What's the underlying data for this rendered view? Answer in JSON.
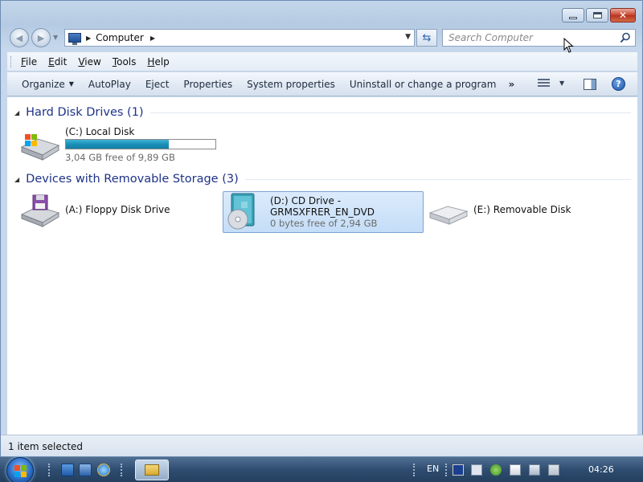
{
  "navigation": {
    "breadcrumb": [
      "Computer"
    ],
    "search_placeholder": "Search Computer"
  },
  "menu": [
    "File",
    "Edit",
    "View",
    "Tools",
    "Help"
  ],
  "menu_mnemonics": [
    "F",
    "E",
    "V",
    "T",
    "H"
  ],
  "commands": {
    "organize": "Organize",
    "autoplay": "AutoPlay",
    "eject": "Eject",
    "properties": "Properties",
    "system_properties": "System properties",
    "uninstall": "Uninstall or change a program",
    "more": "»"
  },
  "groups": [
    {
      "title": "Hard Disk Drives (1)",
      "items": [
        {
          "name": "(C:) Local Disk",
          "info": "3,04 GB free of 9,89 GB",
          "used_fraction": 0.69,
          "icon": "hard-disk-icon"
        }
      ]
    },
    {
      "title": "Devices with Removable Storage (3)",
      "items": [
        {
          "name": "(A:) Floppy Disk Drive",
          "icon": "floppy-drive-icon"
        },
        {
          "name_line1": "(D:) CD Drive -",
          "name_line2": "GRMSXFRER_EN_DVD",
          "info": "0 bytes free of 2,94 GB",
          "icon": "cd-drive-icon",
          "selected": true
        },
        {
          "name": "(E:) Removable Disk",
          "icon": "removable-disk-icon"
        }
      ]
    }
  ],
  "status": "1 item selected",
  "taskbar": {
    "language": "EN",
    "clock": "04:26"
  },
  "colors": {
    "group_title": "#1e3287",
    "selection_bg": "#cfe3fa",
    "usage_fill": "#1b8fb8"
  }
}
